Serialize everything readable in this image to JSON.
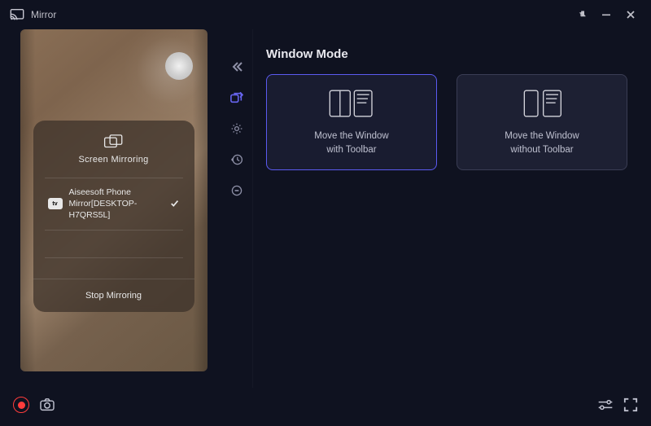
{
  "titlebar": {
    "title": "Mirror"
  },
  "phone": {
    "card_title": "Screen Mirroring",
    "device_badge": "tv",
    "device_name": "Aiseesoft Phone Mirror[DESKTOP-H7QRS5L]",
    "stop_label": "Stop Mirroring"
  },
  "section": {
    "title": "Window Mode"
  },
  "modes": [
    {
      "label_line1": "Move the Window",
      "label_line2": "with Toolbar",
      "selected": true
    },
    {
      "label_line1": "Move the Window",
      "label_line2": "without Toolbar",
      "selected": false
    }
  ]
}
